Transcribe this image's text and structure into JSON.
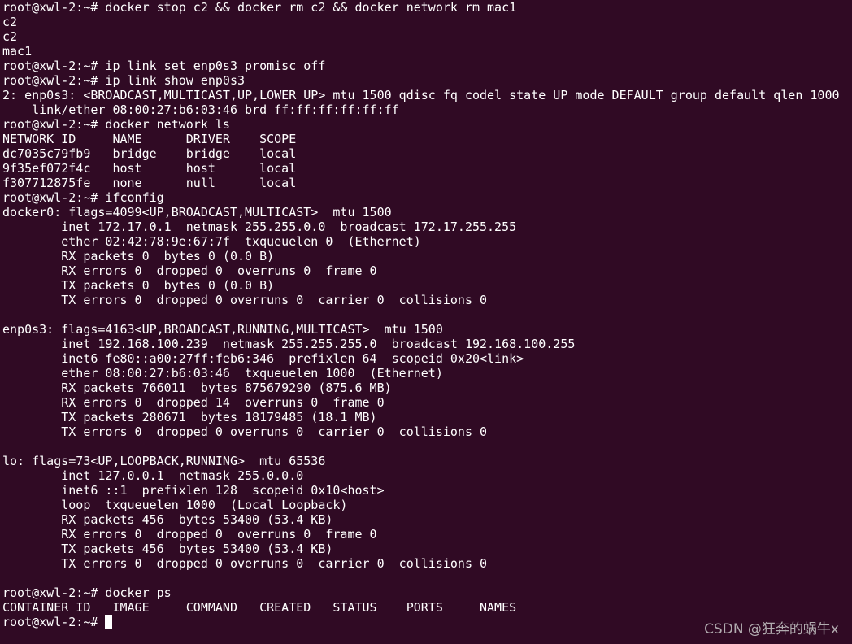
{
  "terminal": {
    "background": "#300a24",
    "foreground": "#ffffff",
    "lines": [
      "root@xwl-2:~# docker stop c2 && docker rm c2 && docker network rm mac1",
      "c2",
      "c2",
      "mac1",
      "root@xwl-2:~# ip link set enp0s3 promisc off",
      "root@xwl-2:~# ip link show enp0s3",
      "2: enp0s3: <BROADCAST,MULTICAST,UP,LOWER_UP> mtu 1500 qdisc fq_codel state UP mode DEFAULT group default qlen 1000",
      "    link/ether 08:00:27:b6:03:46 brd ff:ff:ff:ff:ff:ff",
      "root@xwl-2:~# docker network ls",
      "NETWORK ID     NAME      DRIVER    SCOPE",
      "dc7035c79fb9   bridge    bridge    local",
      "9f35ef072f4c   host      host      local",
      "f307712875fe   none      null      local",
      "root@xwl-2:~# ifconfig",
      "docker0: flags=4099<UP,BROADCAST,MULTICAST>  mtu 1500",
      "        inet 172.17.0.1  netmask 255.255.0.0  broadcast 172.17.255.255",
      "        ether 02:42:78:9e:67:7f  txqueuelen 0  (Ethernet)",
      "        RX packets 0  bytes 0 (0.0 B)",
      "        RX errors 0  dropped 0  overruns 0  frame 0",
      "        TX packets 0  bytes 0 (0.0 B)",
      "        TX errors 0  dropped 0 overruns 0  carrier 0  collisions 0",
      "",
      "enp0s3: flags=4163<UP,BROADCAST,RUNNING,MULTICAST>  mtu 1500",
      "        inet 192.168.100.239  netmask 255.255.255.0  broadcast 192.168.100.255",
      "        inet6 fe80::a00:27ff:feb6:346  prefixlen 64  scopeid 0x20<link>",
      "        ether 08:00:27:b6:03:46  txqueuelen 1000  (Ethernet)",
      "        RX packets 766011  bytes 875679290 (875.6 MB)",
      "        RX errors 0  dropped 14  overruns 0  frame 0",
      "        TX packets 280671  bytes 18179485 (18.1 MB)",
      "        TX errors 0  dropped 0 overruns 0  carrier 0  collisions 0",
      "",
      "lo: flags=73<UP,LOOPBACK,RUNNING>  mtu 65536",
      "        inet 127.0.0.1  netmask 255.0.0.0",
      "        inet6 ::1  prefixlen 128  scopeid 0x10<host>",
      "        loop  txqueuelen 1000  (Local Loopback)",
      "        RX packets 456  bytes 53400 (53.4 KB)",
      "        RX errors 0  dropped 0  overruns 0  frame 0",
      "        TX packets 456  bytes 53400 (53.4 KB)",
      "        TX errors 0  dropped 0 overruns 0  carrier 0  collisions 0",
      "",
      "root@xwl-2:~# docker ps",
      "CONTAINER ID   IMAGE     COMMAND   CREATED   STATUS    PORTS     NAMES"
    ],
    "prompt": "root@xwl-2:~# "
  },
  "watermark": "CSDN @狂奔的蜗牛x"
}
